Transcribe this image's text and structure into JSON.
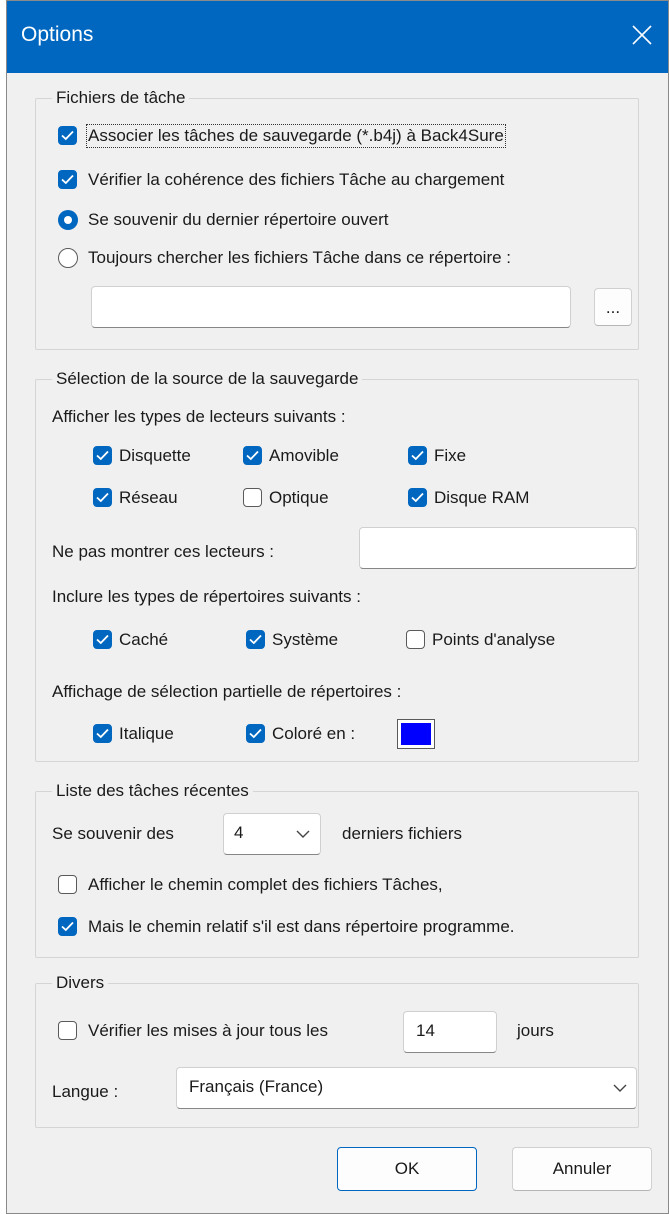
{
  "window": {
    "title": "Options"
  },
  "task_files": {
    "title": "Fichiers de tâche",
    "associate_label": "Associer les tâches de sauvegarde (*.b4j) à Back4Sure",
    "verify_label": "Vérifier la cohérence des fichiers Tâche au chargement",
    "remember_dir_label": "Se souvenir du dernier répertoire ouvert",
    "always_dir_label": "Toujours chercher les fichiers Tâche dans ce répertoire :",
    "dir_value": "",
    "browse_label": "..."
  },
  "source_selection": {
    "title": "Sélection de la source de la sauvegarde",
    "drive_types_label": "Afficher les types de lecteurs suivants :",
    "drives": {
      "floppy": "Disquette",
      "removable": "Amovible",
      "fixed": "Fixe",
      "network": "Réseau",
      "optical": "Optique",
      "ramdisk": "Disque RAM"
    },
    "hide_drives_label": "Ne pas montrer ces lecteurs :",
    "hide_drives_value": "",
    "dir_types_label": "Inclure les types de répertoires suivants :",
    "dirs": {
      "hidden": "Caché",
      "system": "Système",
      "reparse": "Points d'analyse"
    },
    "partial_label": "Affichage de sélection partielle de répertoires :",
    "italic_label": "Italique",
    "colored_label": "Coloré en :",
    "color": "#0000ff"
  },
  "recent": {
    "title": "Liste des tâches récentes",
    "remember_prefix": "Se souvenir des",
    "count_value": "4",
    "remember_suffix": "derniers fichiers",
    "full_path_label": "Afficher le chemin complet des fichiers Tâches,",
    "relative_label": "Mais le chemin relatif s'il est dans répertoire programme."
  },
  "misc": {
    "title": "Divers",
    "updates_prefix": "Vérifier les mises à jour tous les",
    "updates_days": "14",
    "updates_suffix": "jours",
    "language_label": "Langue :",
    "language_value": "Français (France)"
  },
  "buttons": {
    "ok": "OK",
    "cancel": "Annuler"
  },
  "colors": {
    "accent": "#0067c0",
    "face": "#f0f0f0"
  }
}
